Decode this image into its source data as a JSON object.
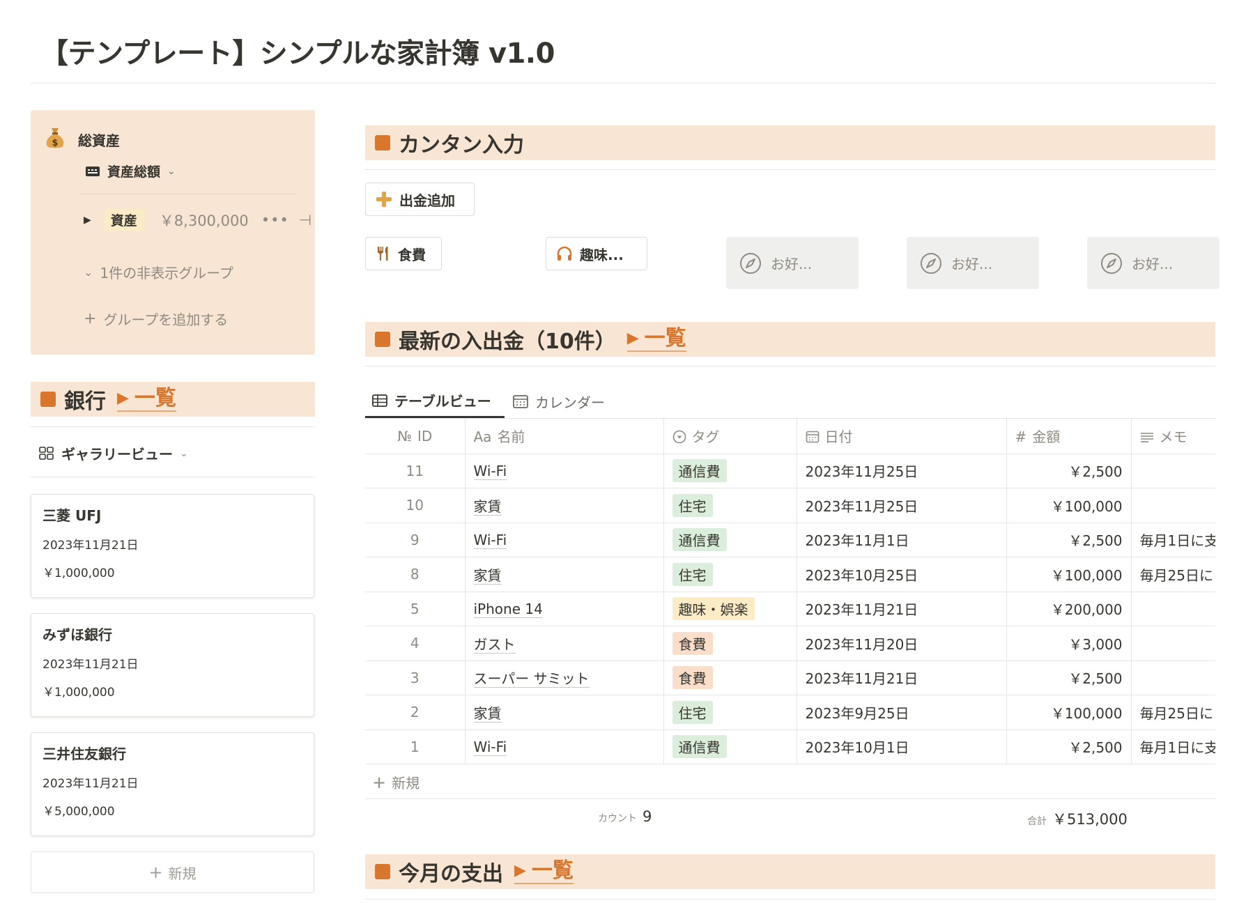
{
  "page": {
    "title": "【テンプレート】シンプルな家計簿 v1.0"
  },
  "colors": {
    "accent": "#d9762e",
    "heading_bg": "#f8e5d3",
    "pill_green": "#dbeddb",
    "pill_yellow": "#fbecc6",
    "pill_orange": "#fadec9"
  },
  "assets": {
    "icon": "money-bag-icon",
    "title": "総資産",
    "view_label": "資産総額",
    "group_tag": "資産",
    "group_amount": "￥8,300,000",
    "dots": "•••",
    "pipe": "⊣",
    "hidden_groups": "1件の非表示グループ",
    "add_group": "グループを追加する"
  },
  "bank": {
    "heading": "銀行",
    "link": "一覧",
    "view_label": "ギャラリービュー",
    "cards": [
      {
        "name": "三菱 UFJ",
        "date": "2023年11月21日",
        "amount": "￥1,000,000"
      },
      {
        "name": "みずほ銀行",
        "date": "2023年11月21日",
        "amount": "￥1,000,000"
      },
      {
        "name": "三井住友銀行",
        "date": "2023年11月21日",
        "amount": "￥5,000,000"
      }
    ],
    "new_label": "新規"
  },
  "quick": {
    "heading": "カンタン入力",
    "add_expense": "出金追加",
    "categories": [
      {
        "label": "食費",
        "icon": "fork-knife-icon"
      },
      {
        "label": "趣味...",
        "icon": "headphones-icon"
      }
    ],
    "favorites": [
      "お好...",
      "お好...",
      "お好..."
    ]
  },
  "recent": {
    "heading": "最新の入出金（10件）",
    "link": "一覧",
    "tabs": [
      "テーブルビュー",
      "カレンダー"
    ],
    "columns": {
      "id_icon": "№",
      "id": "ID",
      "name_icon": "Aa",
      "name": "名前",
      "tag": "タグ",
      "date": "日付",
      "amount_icon": "#",
      "amount": "金額",
      "memo": "メモ"
    },
    "rows": [
      {
        "id": "11",
        "name": "Wi-Fi",
        "tag": "通信費",
        "tag_color": "green",
        "date": "2023年11月25日",
        "amount": "￥2,500",
        "memo": ""
      },
      {
        "id": "10",
        "name": "家賃",
        "tag": "住宅",
        "tag_color": "green",
        "date": "2023年11月25日",
        "amount": "￥100,000",
        "memo": ""
      },
      {
        "id": "9",
        "name": "Wi-Fi",
        "tag": "通信費",
        "tag_color": "green",
        "date": "2023年11月1日",
        "amount": "￥2,500",
        "memo": "毎月1日に支"
      },
      {
        "id": "8",
        "name": "家賃",
        "tag": "住宅",
        "tag_color": "green",
        "date": "2023年10月25日",
        "amount": "￥100,000",
        "memo": "毎月25日に"
      },
      {
        "id": "5",
        "name": "iPhone 14",
        "tag": "趣味・娯楽",
        "tag_color": "yellow",
        "date": "2023年11月21日",
        "amount": "￥200,000",
        "memo": ""
      },
      {
        "id": "4",
        "name": "ガスト",
        "tag": "食費",
        "tag_color": "orange",
        "date": "2023年11月20日",
        "amount": "￥3,000",
        "memo": ""
      },
      {
        "id": "3",
        "name": "スーパー サミット",
        "tag": "食費",
        "tag_color": "orange",
        "date": "2023年11月21日",
        "amount": "￥2,500",
        "memo": ""
      },
      {
        "id": "2",
        "name": "家賃",
        "tag": "住宅",
        "tag_color": "green",
        "date": "2023年9月25日",
        "amount": "￥100,000",
        "memo": "毎月25日に"
      },
      {
        "id": "1",
        "name": "Wi-Fi",
        "tag": "通信費",
        "tag_color": "green",
        "date": "2023年10月1日",
        "amount": "￥2,500",
        "memo": "毎月1日に支"
      }
    ],
    "new_label": "新規",
    "count_label": "カウント",
    "count_value": "9",
    "sum_label": "合計",
    "sum_value": "￥513,000"
  },
  "monthly": {
    "heading": "今月の支出",
    "link": "一覧"
  }
}
